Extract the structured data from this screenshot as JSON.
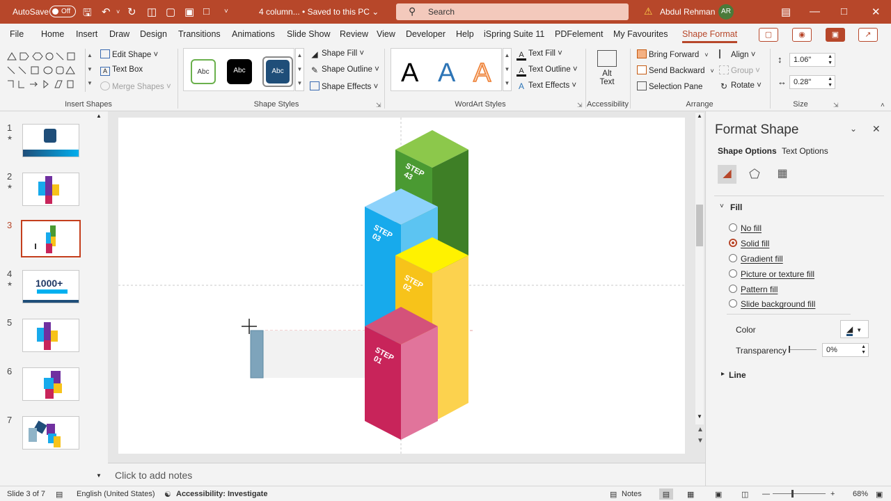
{
  "titlebar": {
    "autosave_label": "AutoSave",
    "autosave_state": "Off",
    "file_title": "4 column... • Saved to this PC ⌄",
    "search_placeholder": "Search",
    "user_name": "Abdul Rehman",
    "user_initials": "AR"
  },
  "menu": {
    "tabs": [
      "File",
      "Home",
      "Insert",
      "Draw",
      "Design",
      "Transitions",
      "Animations",
      "Slide Show",
      "Review",
      "View",
      "Developer",
      "Help",
      "iSpring Suite 11",
      "PDFelement",
      "My Favourites",
      "Shape Format"
    ],
    "active": "Shape Format"
  },
  "ribbon": {
    "insert_shapes": {
      "label": "Insert Shapes",
      "edit_shape": "Edit Shape ˅",
      "text_box": "Text Box",
      "merge_shapes": "Merge Shapes ˅"
    },
    "shape_styles": {
      "label": "Shape Styles",
      "abc": "Abc",
      "shape_fill": "Shape Fill ˅",
      "shape_outline": "Shape Outline ˅",
      "shape_effects": "Shape Effects ˅"
    },
    "wordart": {
      "label": "WordArt Styles",
      "letter": "A",
      "text_fill": "Text Fill ˅",
      "text_outline": "Text Outline ˅",
      "text_effects": "Text Effects ˅"
    },
    "accessibility": {
      "label": "Accessibility",
      "alt_text_line1": "Alt",
      "alt_text_line2": "Text"
    },
    "arrange": {
      "label": "Arrange",
      "bring_forward": "Bring Forward",
      "send_backward": "Send Backward",
      "selection_pane": "Selection Pane",
      "align": "Align ˅",
      "group": "Group ˅",
      "rotate": "Rotate ˅"
    },
    "size": {
      "label": "Size",
      "height": "1.06\"",
      "width": "0.28\""
    }
  },
  "thumbnails": [
    {
      "num": "1",
      "star": "★"
    },
    {
      "num": "2",
      "star": "★"
    },
    {
      "num": "3",
      "star": ""
    },
    {
      "num": "4",
      "star": "★"
    },
    {
      "num": "5",
      "star": ""
    },
    {
      "num": "6",
      "star": ""
    },
    {
      "num": "7",
      "star": ""
    }
  ],
  "thumb4_text": "1000+",
  "slide": {
    "steps": [
      {
        "label": "STEP\n01",
        "front": "#c8245a",
        "side": "#e1749b",
        "top": "#d4527a"
      },
      {
        "label": "STEP\n02",
        "front": "#f7c31a",
        "side": "#fcd24e",
        "top": "#fff200"
      },
      {
        "label": "STEP\n03",
        "front": "#17aaec",
        "side": "#5cc4f2",
        "top": "#8dd2fb"
      },
      {
        "label": "STEP\n43",
        "front": "#4a9a32",
        "side": "#3e7f26",
        "top": "#8cc84b"
      }
    ]
  },
  "notes_placeholder": "Click to add notes",
  "format_pane": {
    "title": "Format Shape",
    "tab_shape": "Shape Options",
    "tab_text": "Text Options",
    "section_fill": "Fill",
    "options": [
      "No fill",
      "Solid fill",
      "Gradient fill",
      "Picture or texture fill",
      "Pattern fill",
      "Slide background fill"
    ],
    "selected": "Solid fill",
    "color_label": "Color",
    "transparency_label": "Transparency",
    "transparency_value": "0%",
    "section_line": "Line"
  },
  "status": {
    "slide_count": "Slide 3 of 7",
    "language": "English (United States)",
    "accessibility": "Accessibility: Investigate",
    "notes": "Notes",
    "zoom": "68%"
  },
  "colors": {
    "accent": "#b7472a",
    "selected_thumb": "#c43e1c"
  }
}
